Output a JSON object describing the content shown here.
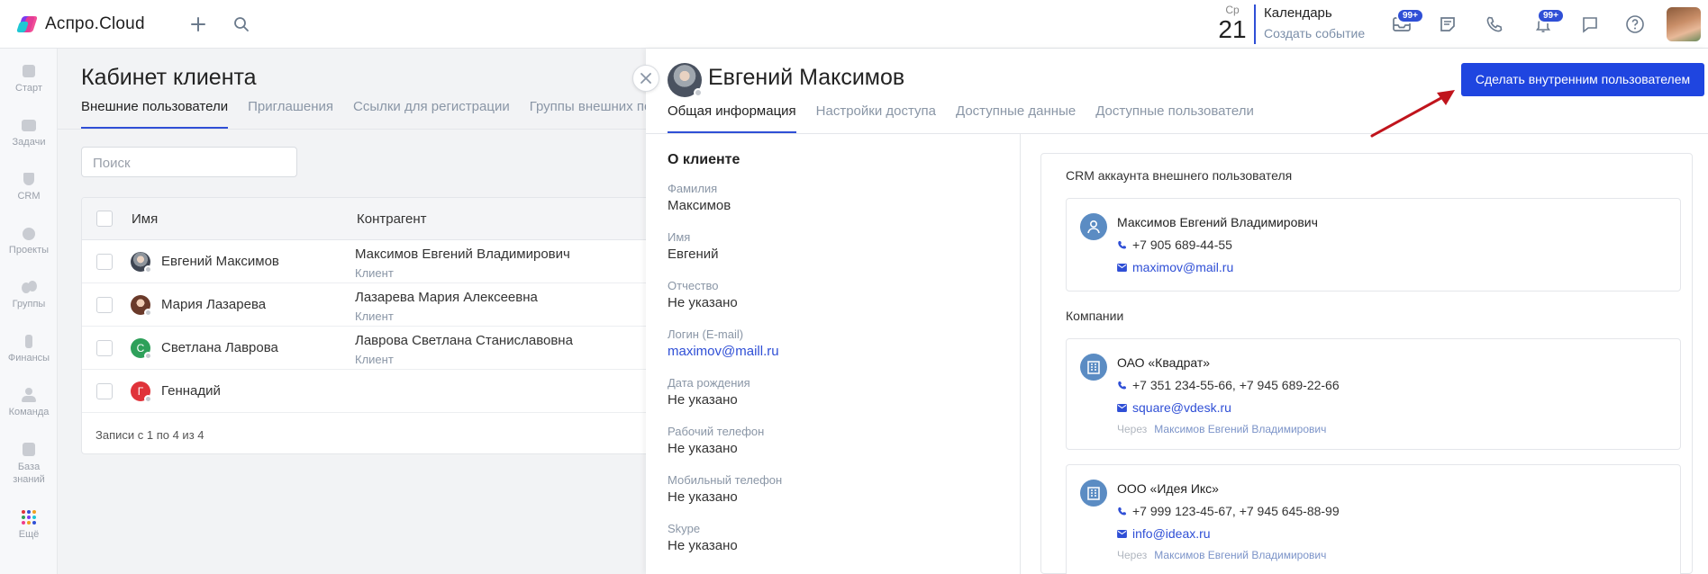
{
  "header": {
    "logo_text": "Аспро.Cloud",
    "date_dow": "Ср",
    "date_num": "21",
    "calendar_title": "Календарь",
    "calendar_sub": "Создать событие",
    "mail_badge": "99+",
    "notif_badge": "99+"
  },
  "sidebar": {
    "items": [
      {
        "label": "Старт",
        "icon": "home-icon"
      },
      {
        "label": "Задачи",
        "icon": "tasks-icon"
      },
      {
        "label": "CRM",
        "icon": "crm-icon"
      },
      {
        "label": "Проекты",
        "icon": "projects-icon"
      },
      {
        "label": "Группы",
        "icon": "groups-icon"
      },
      {
        "label": "Финансы",
        "icon": "finance-icon"
      },
      {
        "label": "Команда",
        "icon": "team-icon"
      },
      {
        "label": "База знаний",
        "icon": "knowledge-icon"
      },
      {
        "label": "Ещё",
        "icon": "more-icon"
      }
    ]
  },
  "page": {
    "title": "Кабинет клиента",
    "tabs": [
      "Внешние пользователи",
      "Приглашения",
      "Ссылки для регистрации",
      "Группы внешних по"
    ],
    "search_placeholder": "Поиск",
    "table": {
      "columns": [
        "Имя",
        "Контрагент"
      ],
      "rows": [
        {
          "name": "Евгений Максимов",
          "org": "Максимов Евгений Владимирович",
          "role": "Клиент",
          "avatar": "",
          "avatar_color": "#6b7480"
        },
        {
          "name": "Мария Лазарева",
          "org": "Лазарева Мария Алексеевна",
          "role": "Клиент",
          "avatar": "",
          "avatar_color": "#8a4a3a"
        },
        {
          "name": "Светлана Лаврова",
          "org": "Лаврова Светлана Станиславовна",
          "role": "Клиент",
          "avatar": "С",
          "avatar_color": "#2ea05a"
        },
        {
          "name": "Геннадий",
          "org": "",
          "role": "",
          "avatar": "Г",
          "avatar_color": "#e0333a"
        }
      ],
      "footer": "Записи с 1 по 4 из 4"
    }
  },
  "panel": {
    "name": "Евгений Максимов",
    "primary_button": "Сделать внутренним пользователем",
    "tabs": [
      "Общая информация",
      "Настройки доступа",
      "Доступные данные",
      "Доступные пользователи"
    ],
    "about_title": "О клиенте",
    "fields": [
      {
        "label": "Фамилия",
        "value": "Максимов",
        "link": false
      },
      {
        "label": "Имя",
        "value": "Евгений",
        "link": false
      },
      {
        "label": "Отчество",
        "value": "Не указано",
        "link": false
      },
      {
        "label": "Логин (E-mail)",
        "value": "maximov@maill.ru",
        "link": true
      },
      {
        "label": "Дата рождения",
        "value": "Не указано",
        "link": false
      },
      {
        "label": "Рабочий телефон",
        "value": "Не указано",
        "link": false
      },
      {
        "label": "Мобильный телефон",
        "value": "Не указано",
        "link": false
      },
      {
        "label": "Skype",
        "value": "Не указано",
        "link": false
      }
    ],
    "crm_title": "CRM аккаунта внешнего пользователя",
    "crm_card": {
      "name": "Максимов Евгений Владимирович",
      "phone": "+7 905 689-44-55",
      "email": "maximov@mail.ru"
    },
    "companies_title": "Компании",
    "companies": [
      {
        "name": "ОАО «Квадрат»",
        "phone": "+7 351 234-55-66, +7 945 689-22-66",
        "email": "square@vdesk.ru",
        "via_label": "Через",
        "via_name": "Максимов Евгений Владимирович"
      },
      {
        "name": "ООО «Идея Икс»",
        "phone": "+7 999 123-45-67, +7 945 645-88-99",
        "email": "info@ideax.ru",
        "via_label": "Через",
        "via_name": "Максимов Евгений Владимирович"
      }
    ]
  },
  "colors": {
    "accent": "#2f4fd6",
    "primary_button": "#1f45e0",
    "arrow": "#c0141c"
  }
}
